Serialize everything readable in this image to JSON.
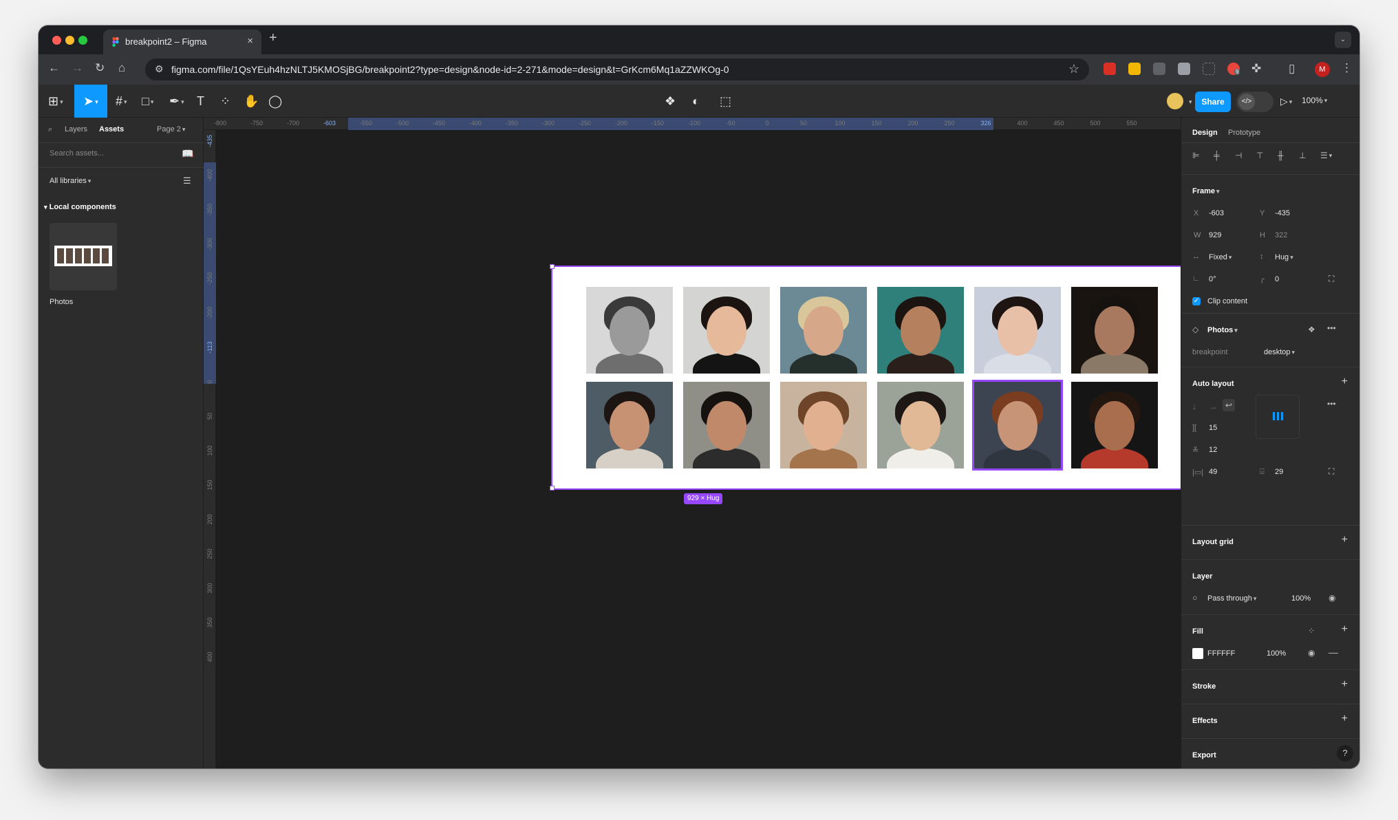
{
  "browser": {
    "tab_title": "breakpoint2 – Figma",
    "url": "figma.com/file/1QsYEuh4hzNLTJ5KMOSjBG/breakpoint2?type=design&node-id=2-271&mode=design&t=GrKcm6Mq1aZZWKOg-0",
    "profile_initial": "M",
    "extension_badge": "9"
  },
  "toolbar": {
    "share_label": "Share",
    "zoom": "100%"
  },
  "left_panel": {
    "tab_layers": "Layers",
    "tab_assets": "Assets",
    "page": "Page 2",
    "search_placeholder": "Search assets...",
    "libraries": "All libraries",
    "local_components": "Local components",
    "component_name": "Photos"
  },
  "rulers": {
    "top": [
      {
        "label": "-800",
        "hl": false
      },
      {
        "label": "-750",
        "hl": false
      },
      {
        "label": "-700",
        "hl": false
      },
      {
        "label": "-603",
        "hl": true
      },
      {
        "label": "-550",
        "hl": false
      },
      {
        "label": "-500",
        "hl": false
      },
      {
        "label": "-450",
        "hl": false
      },
      {
        "label": "-400",
        "hl": false
      },
      {
        "label": "-350",
        "hl": false
      },
      {
        "label": "-300",
        "hl": false
      },
      {
        "label": "-250",
        "hl": false
      },
      {
        "label": "-200",
        "hl": false
      },
      {
        "label": "-150",
        "hl": false
      },
      {
        "label": "-100",
        "hl": false
      },
      {
        "label": "-50",
        "hl": false
      },
      {
        "label": "0",
        "hl": false
      },
      {
        "label": "50",
        "hl": false
      },
      {
        "label": "100",
        "hl": false
      },
      {
        "label": "150",
        "hl": false
      },
      {
        "label": "200",
        "hl": false
      },
      {
        "label": "250",
        "hl": false
      },
      {
        "label": "326",
        "hl": true
      },
      {
        "label": "400",
        "hl": false
      },
      {
        "label": "450",
        "hl": false
      },
      {
        "label": "500",
        "hl": false
      },
      {
        "label": "550",
        "hl": false
      }
    ],
    "left": [
      {
        "label": "-435",
        "hl": true
      },
      {
        "label": "-400",
        "hl": false
      },
      {
        "label": "-350",
        "hl": false
      },
      {
        "label": "-300",
        "hl": false
      },
      {
        "label": "-250",
        "hl": false
      },
      {
        "label": "-200",
        "hl": false
      },
      {
        "label": "-113",
        "hl": true
      },
      {
        "label": "0",
        "hl": false
      },
      {
        "label": "50",
        "hl": false
      },
      {
        "label": "100",
        "hl": false
      },
      {
        "label": "150",
        "hl": false
      },
      {
        "label": "200",
        "hl": false
      },
      {
        "label": "250",
        "hl": false
      },
      {
        "label": "300",
        "hl": false
      },
      {
        "label": "350",
        "hl": false
      },
      {
        "label": "400",
        "hl": false
      }
    ]
  },
  "canvas": {
    "size_badge": "929 × Hug",
    "photos": [
      {
        "skin": "#9a9a9a",
        "hair": "#3a3a3a",
        "cloth": "#6e6e6e",
        "bg": "#d8d8d8"
      },
      {
        "skin": "#e5b99a",
        "hair": "#1b1410",
        "cloth": "#141414",
        "bg": "#d4d4d2"
      },
      {
        "skin": "#d7a789",
        "hair": "#d9c69a",
        "cloth": "#25302c",
        "bg": "#6c8a96"
      },
      {
        "skin": "#b5805d",
        "hair": "#1c1410",
        "cloth": "#2a1f1a",
        "bg": "#2f7f7a"
      },
      {
        "skin": "#e8c0a8",
        "hair": "#1e1513",
        "cloth": "#d8dde6",
        "bg": "#c9cfda"
      },
      {
        "skin": "#a8795e",
        "hair": "#161210",
        "cloth": "#8a7966",
        "bg": "#1a1410"
      },
      {
        "skin": "#c79173",
        "hair": "#1c1511",
        "cloth": "#d6d0c6",
        "bg": "#4e5c66"
      },
      {
        "skin": "#c08a6a",
        "hair": "#151210",
        "cloth": "#2c2c2c",
        "bg": "#8f8f88"
      },
      {
        "skin": "#e0b090",
        "hair": "#6e4528",
        "cloth": "#a4744c",
        "bg": "#c8b49e"
      },
      {
        "skin": "#e2b996",
        "hair": "#1d1816",
        "cloth": "#f0eee8",
        "bg": "#9ba399"
      },
      {
        "skin": "#c89478",
        "hair": "#7a3d1f",
        "cloth": "#2f3640",
        "bg": "#3b4450"
      },
      {
        "skin": "#a86e4e",
        "hair": "#23170f",
        "cloth": "#b53a2c",
        "bg": "#151515"
      }
    ]
  },
  "right_panel": {
    "tab_design": "Design",
    "tab_prototype": "Prototype",
    "frame_title": "Frame",
    "x_label": "X",
    "x": "-603",
    "y_label": "Y",
    "y": "-435",
    "w_label": "W",
    "w": "929",
    "h_label": "H",
    "h": "322",
    "width_mode": "Fixed",
    "height_mode": "Hug",
    "rotation": "0°",
    "radius": "0",
    "clip_content": "Clip content",
    "component": "Photos",
    "prop_name": "breakpoint",
    "prop_value": "desktop",
    "auto_layout": "Auto layout",
    "gap": "15",
    "vertical_gap": "12",
    "pad_h": "49",
    "pad_v": "29",
    "layout_grid": "Layout grid",
    "layer_title": "Layer",
    "blend": "Pass through",
    "opacity": "100%",
    "fill_title": "Fill",
    "fill_hex": "FFFFFF",
    "fill_opacity": "100%",
    "stroke": "Stroke",
    "effects": "Effects",
    "export": "Export",
    "help": "?"
  }
}
